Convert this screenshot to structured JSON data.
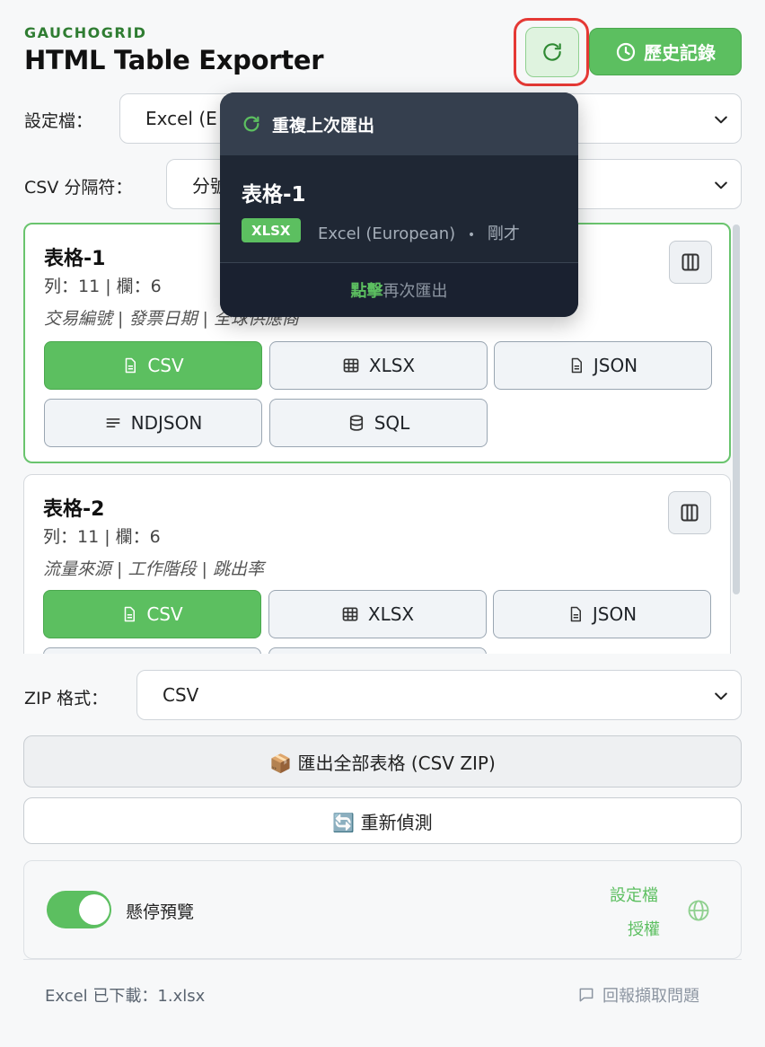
{
  "header": {
    "brand": "GAUCHOGRID",
    "title": "HTML Table Exporter",
    "history_label": "歷史記錄"
  },
  "settings": {
    "profile_label": "設定檔：",
    "profile_value": "Excel (E",
    "csv_sep_label": "CSV 分隔符：",
    "csv_sep_value": "分號"
  },
  "tables": [
    {
      "title": "表格-1",
      "meta": "列：11 | 欄：6",
      "columns": "交易編號 | 發票日期 | 全球供應商",
      "formats": [
        "CSV",
        "XLSX",
        "JSON",
        "NDJSON",
        "SQL"
      ]
    },
    {
      "title": "表格-2",
      "meta": "列：11 | 欄：6",
      "columns": "流量來源 | 工作階段 | 跳出率",
      "formats": [
        "CSV",
        "XLSX",
        "JSON"
      ]
    }
  ],
  "zip": {
    "label": "ZIP 格式：",
    "value": "CSV",
    "export_all": "📦 匯出全部表格 (CSV ZIP)",
    "rescan": "🔄 重新偵測"
  },
  "footer": {
    "hover_preview": "懸停預覽",
    "profile_link": "設定檔",
    "license_link": "授權",
    "status": "Excel 已下載：1.xlsx",
    "report": "回報擷取問題"
  },
  "popover": {
    "header": "重複上次匯出",
    "table_title": "表格-1",
    "badge": "XLSX",
    "profile": "Excel (European)",
    "dot": "•",
    "time": "剛才",
    "click": "點擊",
    "again": "再次匯出"
  },
  "colors": {
    "accent": "#5cbf60",
    "brand": "#2f7d32",
    "highlight_ring": "#e53935",
    "popover_bg": "#1f2734"
  }
}
